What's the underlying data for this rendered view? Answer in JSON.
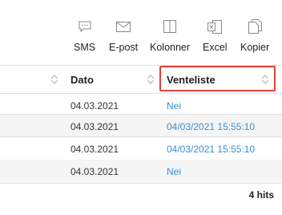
{
  "toolbar": {
    "items": [
      {
        "label": "SMS",
        "icon": "sms-icon"
      },
      {
        "label": "E-post",
        "icon": "envelope-icon"
      },
      {
        "label": "Kolonner",
        "icon": "columns-icon"
      },
      {
        "label": "Excel",
        "icon": "excel-icon"
      },
      {
        "label": "Kopier",
        "icon": "copy-icon"
      }
    ]
  },
  "table": {
    "columns": [
      "Dato",
      "Venteliste"
    ],
    "rows": [
      {
        "date": "04.03.2021",
        "waitlist": "Nei"
      },
      {
        "date": "04.03.2021",
        "waitlist": "04/03/2021 15:55:10"
      },
      {
        "date": "04.03.2021",
        "waitlist": "04/03/2021 15:55:10"
      },
      {
        "date": "04.03.2021",
        "waitlist": "Nei"
      }
    ]
  },
  "footer": {
    "hits": "4 hits"
  },
  "colors": {
    "link": "#3a8fd0",
    "highlight": "#e0433a",
    "alt_row": "#f5f5f6"
  }
}
